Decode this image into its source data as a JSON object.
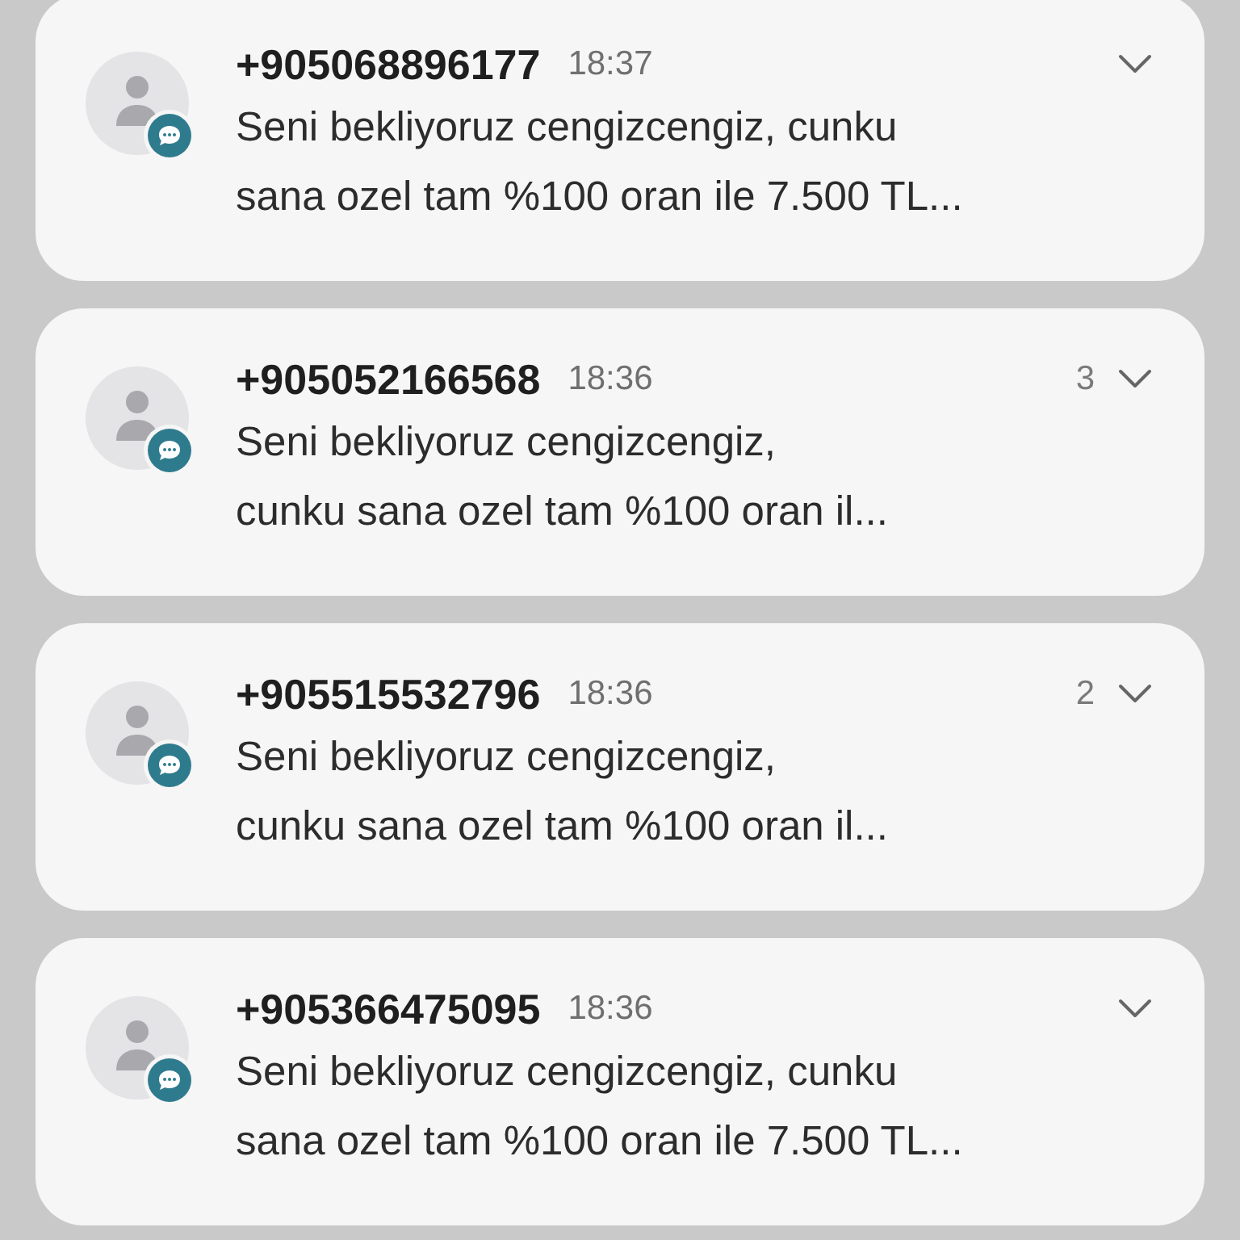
{
  "notifications": [
    {
      "sender": "+905068896177",
      "time": "18:37",
      "lines": [
        "Seni bekliyoruz cengizcengiz, cunku",
        "sana ozel tam %100 oran ile 7.500 TL..."
      ]
    },
    {
      "sender": "+905052166568",
      "time": "18:36",
      "count": "3",
      "lines": [
        "Seni bekliyoruz cengizcengiz,",
        "cunku sana ozel tam %100 oran il..."
      ]
    },
    {
      "sender": "+905515532796",
      "time": "18:36",
      "count": "2",
      "lines": [
        "Seni bekliyoruz cengizcengiz,",
        "cunku sana ozel tam %100 oran il..."
      ]
    },
    {
      "sender": "+905366475095",
      "time": "18:36",
      "lines": [
        "Seni bekliyoruz cengizcengiz, cunku",
        "sana ozel tam %100 oran ile 7.500 TL..."
      ]
    }
  ]
}
